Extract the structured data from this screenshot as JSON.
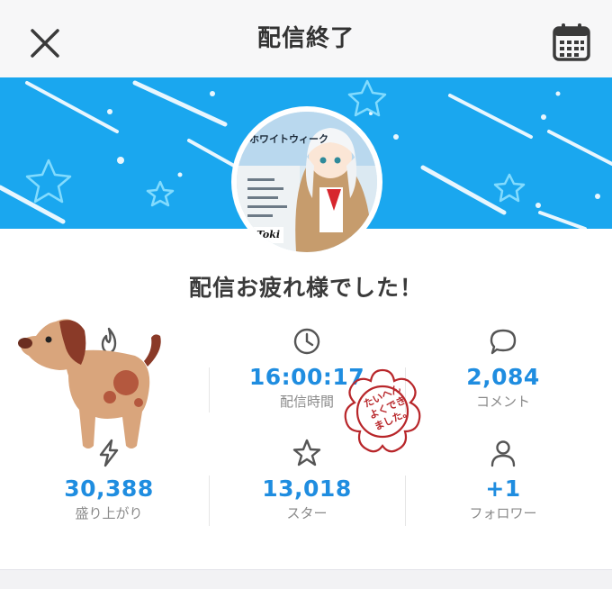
{
  "header": {
    "title": "配信終了",
    "close_icon": "close-icon",
    "calendar_icon": "calendar-icon"
  },
  "banner": {
    "color": "#1aa7ef"
  },
  "avatar": {
    "label_top": "ホワイトウィーク",
    "label_name": "Toki"
  },
  "message": "配信お疲れ様でした！",
  "stats": [
    {
      "id": "fire",
      "icon": "fire-icon",
      "value": "",
      "label": ""
    },
    {
      "id": "duration",
      "icon": "clock-icon",
      "value": "16:00:17",
      "label": "配信時間"
    },
    {
      "id": "comments",
      "icon": "comment-icon",
      "value": "2,084",
      "label": "コメント"
    },
    {
      "id": "excitement",
      "icon": "lightning-icon",
      "value": "30,388",
      "label": "盛り上がり"
    },
    {
      "id": "stars",
      "icon": "star-icon",
      "value": "13,018",
      "label": "スター"
    },
    {
      "id": "followers",
      "icon": "person-icon",
      "value": "+1",
      "label": "フォロワー"
    }
  ],
  "stamp": {
    "text": "たいへんよくできました。",
    "color": "#b8262a"
  },
  "accent": "#1f8de0"
}
